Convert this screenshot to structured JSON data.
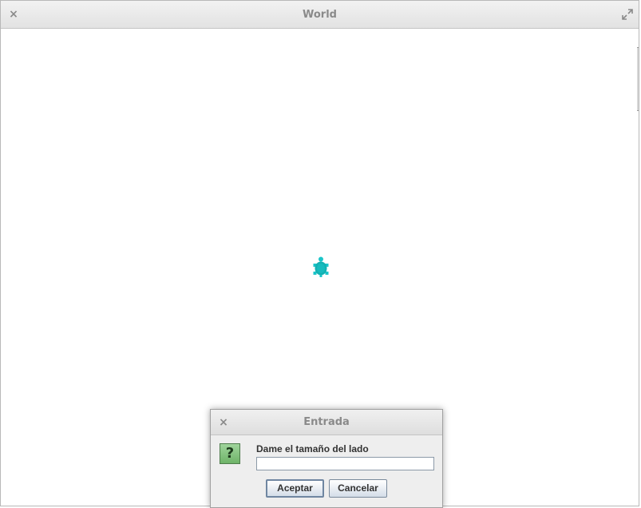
{
  "window": {
    "title": "World",
    "close_glyph": "×",
    "close_icon": "close-icon",
    "maximize_icon": "maximize-icon"
  },
  "canvas": {
    "turtle_icon": "turtle-icon",
    "turtle_color": "#1bc5c9"
  },
  "dialog": {
    "title": "Entrada",
    "close_glyph": "×",
    "question_glyph": "?",
    "question_icon": "question-icon",
    "prompt": "Dame el tamaño del lado",
    "input_value": "",
    "ok_label": "Aceptar",
    "cancel_label": "Cancelar"
  }
}
